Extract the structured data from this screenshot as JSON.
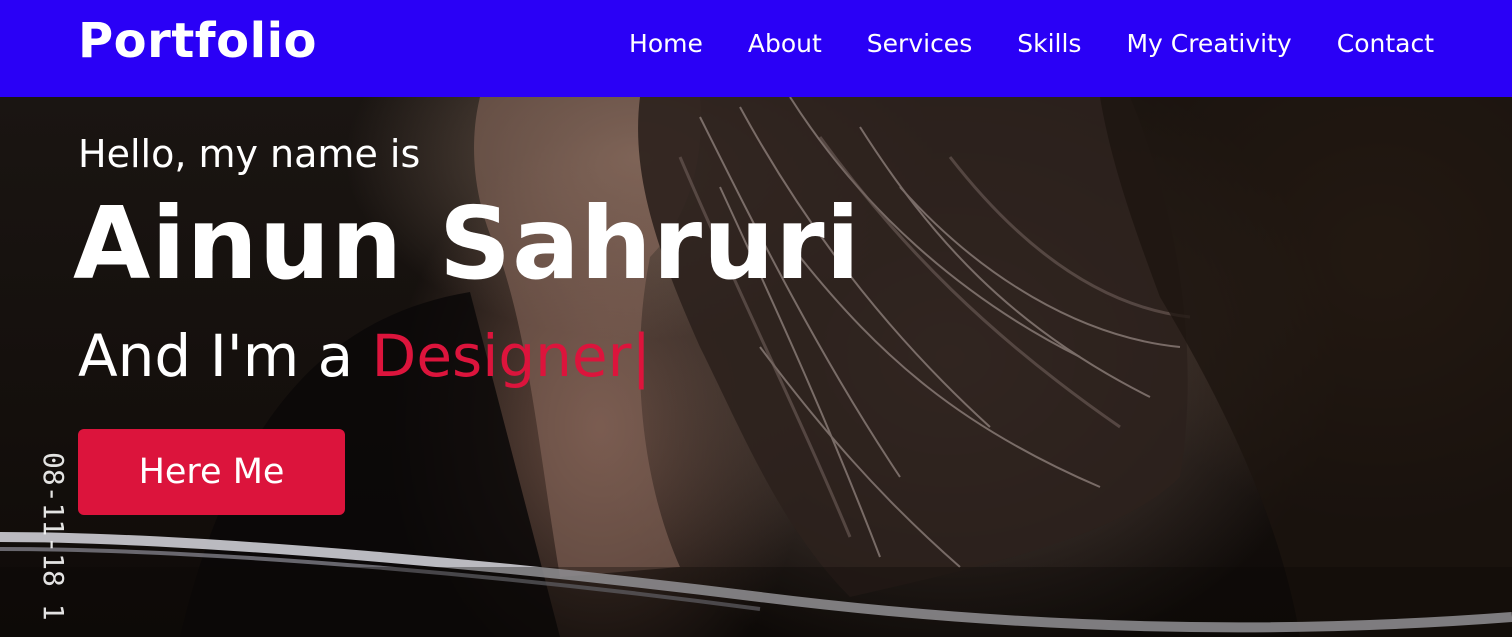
{
  "nav": {
    "logo": "Portfolio",
    "items": [
      {
        "label": "Home"
      },
      {
        "label": "About"
      },
      {
        "label": "Services"
      },
      {
        "label": "Skills"
      },
      {
        "label": "My Creativity"
      },
      {
        "label": "Contact"
      }
    ]
  },
  "hero": {
    "greeting": "Hello, my name is",
    "name": "Ainun Sahruri",
    "role_prefix": "And I'm a ",
    "role": "Designer",
    "cursor": "|",
    "button_label": "Here Me",
    "photo_date_stamp": "08-11-18 1"
  },
  "colors": {
    "navbar": "#2a00f6",
    "accent": "#dc143c",
    "text": "#ffffff"
  }
}
